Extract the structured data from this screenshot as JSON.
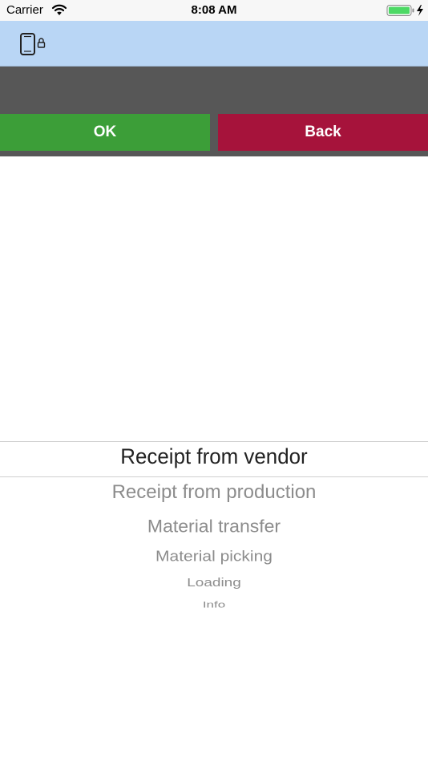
{
  "status_bar": {
    "carrier": "Carrier",
    "time": "8:08 AM",
    "wifi_icon": "wifi-icon",
    "battery_icon": "battery-charging-icon",
    "battery_color": "#4cd964"
  },
  "header": {
    "icon": "device-lock-icon",
    "background": "#b9d6f5"
  },
  "toolbar": {
    "ok_label": "OK",
    "back_label": "Back",
    "ok_color": "#3c9e38",
    "back_color": "#a6133b"
  },
  "picker": {
    "selected": "Receipt from vendor",
    "items": [
      "Receipt from vendor",
      "Receipt from production",
      "Material transfer",
      "Material picking",
      "Loading",
      "Info"
    ]
  }
}
